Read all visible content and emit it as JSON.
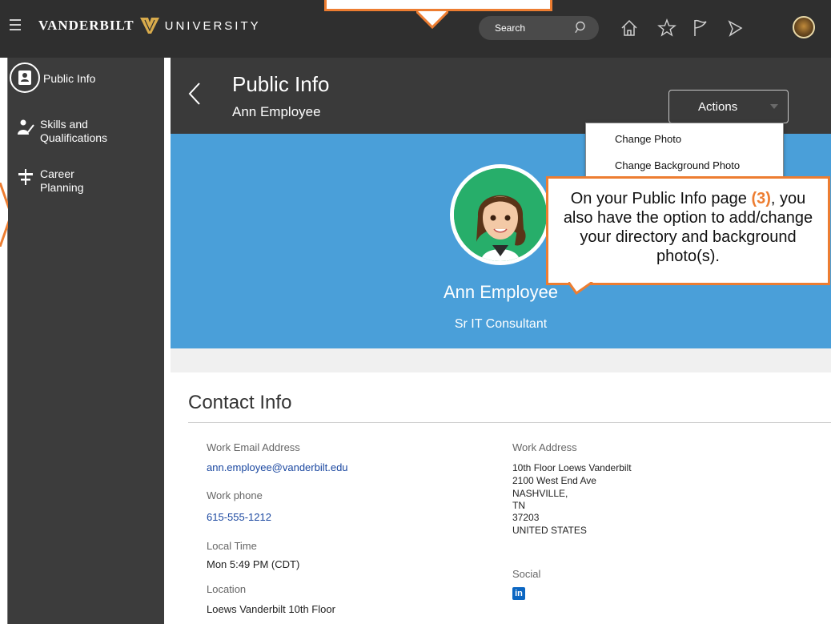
{
  "header": {
    "brand_left": "VANDERBILT",
    "brand_right": "UNIVERSITY",
    "search_placeholder": "Search"
  },
  "sidebar": {
    "items": [
      {
        "label": "Public Info",
        "icon": "badge-icon",
        "active": true
      },
      {
        "label": "Skills and Qualifications",
        "icon": "skills-icon",
        "active": false
      },
      {
        "label": "Career Planning",
        "icon": "signpost-icon",
        "active": false
      }
    ]
  },
  "page": {
    "title": "Public Info",
    "subtitle": "Ann Employee",
    "actions_label": "Actions"
  },
  "actions_menu": {
    "items": [
      "Change Photo",
      "Change Background Photo"
    ]
  },
  "banner": {
    "name": "Ann Employee",
    "job_title": "Sr IT Consultant",
    "color": "#4a9fd9"
  },
  "callout": {
    "text_before": "On your Public Info page ",
    "number": "(3)",
    "text_after": ", you also have the option to add/change your directory and background photo(s).",
    "color": "#ed7d31"
  },
  "contact": {
    "heading": "Contact Info",
    "work_email_label": "Work Email Address",
    "work_email": "ann.employee@vanderbilt.edu",
    "work_phone_label": "Work phone",
    "work_phone": "615-555-1212",
    "local_time_label": "Local Time",
    "local_time": "Mon 5:49 PM (CDT)",
    "location_label": "Location",
    "location": "Loews Vanderbilt 10th Floor",
    "work_address_label": "Work Address",
    "address_lines": [
      "10th Floor Loews Vanderbilt",
      "2100 West End Ave",
      "NASHVILLE,",
      "TN",
      "37203",
      "UNITED STATES"
    ],
    "social_label": "Social",
    "social_icon_text": "in"
  }
}
